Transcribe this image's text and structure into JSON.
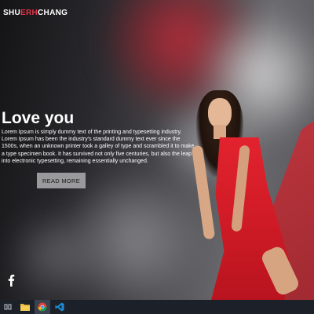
{
  "header": {
    "brand_part1": "SHU",
    "brand_accent": "ERH",
    "brand_part2": "CHANG"
  },
  "hero": {
    "title": "Love you",
    "body": "Lorem Ipsum is simply dummy text of the printing and typesetting industry. Lorem Ipsum has been the industry's standard dummy text ever since the 1500s, when an unknown printer took a galley of type and scrambled it to make a type specimen book. It has survived not only five centuries, but also the leap into electronic typesetting, remaining essentially unchanged.",
    "button_label": "READ MORE"
  },
  "social": {
    "icon": "facebook-icon"
  },
  "taskbar": {
    "items": [
      {
        "icon": "task-view-icon"
      },
      {
        "icon": "file-explorer-icon"
      },
      {
        "icon": "chrome-icon"
      },
      {
        "icon": "vscode-icon"
      }
    ]
  },
  "colors": {
    "accent": "#e3344a",
    "dress": "#d21c27",
    "button_bg": "#9a9a9c",
    "taskbar": "#1c2129"
  }
}
